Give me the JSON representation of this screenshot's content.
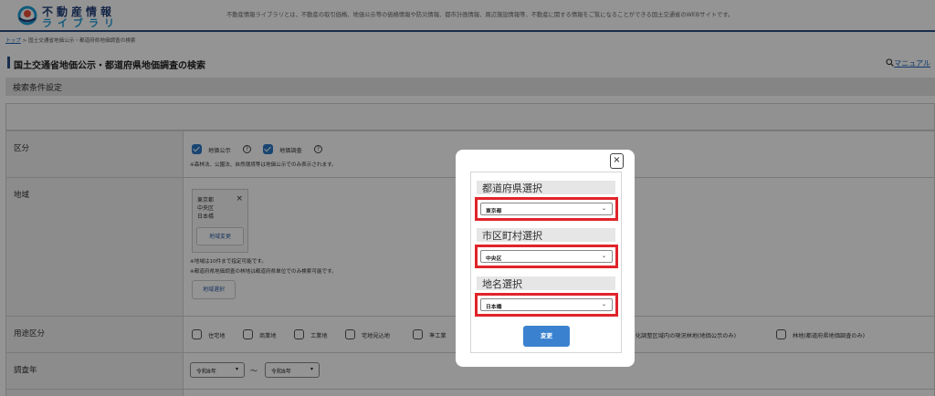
{
  "header": {
    "logo_line1": "不動産情報",
    "logo_line2": "ライブラリ",
    "tagline": "不動産情報ライブラリとは、不動産の取引価格、地価公示等の価格情報や防災情報、都市計画情報、周辺施設情報等、不動産に関する情報をご覧になることができる国土交通省のWEBサイトです。"
  },
  "breadcrumb": {
    "top": "トップ",
    "separator": " > ",
    "current": "国土交通省地価公示・都道府県地価調査の検索"
  },
  "page": {
    "title": "国土交通省地価公示・都道府県地価調査の検索",
    "manual_label": "マニュアル",
    "manual_icon": "search-icon"
  },
  "section": {
    "title": "検索条件設定"
  },
  "form": {
    "kubun": {
      "label": "区分",
      "opt1": "地価公示",
      "opt2": "地価調査",
      "help": "?",
      "note": "※森林法、公園法、自然環境等は地価公示でのみ表示されます。"
    },
    "chiiki": {
      "label": "地域",
      "selected": [
        "東京都",
        "中央区",
        "日本橋"
      ],
      "remove": "×",
      "change_button": "地域変更",
      "note1": "※地域は10件まで指定可能です。",
      "note2": "※都道府県地価調査の林地は都道府県単位でのみ検索可能です。",
      "select_button": "地域選択"
    },
    "youto": {
      "label": "用途区分",
      "options": [
        "住宅地",
        "商業地",
        "工業地",
        "宅地見込地",
        "準工業"
      ],
      "options_right": [
        "化調整区域内の現況林地(地価公示のみ)",
        "林地(都道府県地価調査のみ)"
      ]
    },
    "year": {
      "label": "調査年",
      "from": "令和8年",
      "sep": "～",
      "to": "令和8年"
    }
  },
  "modal": {
    "close": "×",
    "prefecture": {
      "heading": "都道府県選択",
      "value": "東京都"
    },
    "city": {
      "heading": "市区町村選択",
      "value": "中央区"
    },
    "place": {
      "heading": "地名選択",
      "value": "日本橋"
    },
    "submit": "変更"
  },
  "colors": {
    "brand": "#2c4f85",
    "accent": "#3a82cf",
    "highlight": "#e0242a"
  }
}
